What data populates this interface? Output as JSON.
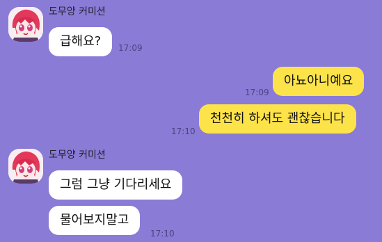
{
  "messages": [
    {
      "sender": "도무양 커미션",
      "text": "급해요?",
      "time": "17:09",
      "direction": "incoming"
    },
    {
      "text": "아뇨아니예요",
      "time": "17:09",
      "direction": "outgoing"
    },
    {
      "text": "천천히 하셔도 괜찮습니다",
      "time": "17:10",
      "direction": "outgoing"
    },
    {
      "sender": "도무양 커미션",
      "text": "그럼 그냥 기다리세요",
      "direction": "incoming"
    },
    {
      "text": "물어보지말고",
      "time": "17:10",
      "direction": "incoming"
    }
  ],
  "avatar": {
    "icon": "anime-girl-avatar",
    "hair_color": "#e2385b",
    "eye_color": "#d43a7f"
  },
  "colors": {
    "background": "#8a7bd6",
    "incoming_bubble": "#ffffff",
    "outgoing_bubble": "#fde34a"
  }
}
